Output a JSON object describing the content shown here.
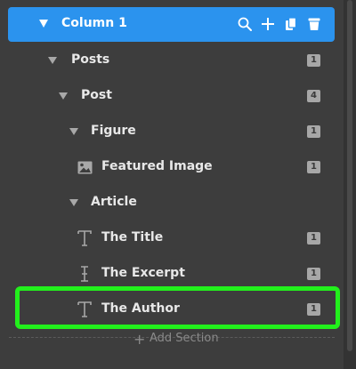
{
  "header": {
    "title": "Column 1",
    "bg_color": "#2b93ee",
    "actions": [
      "search-icon",
      "plus-icon",
      "duplicate-icon",
      "trash-icon"
    ]
  },
  "tree": [
    {
      "label": "Posts",
      "badge": "1",
      "expanded": true,
      "icon": null
    },
    {
      "label": "Post",
      "badge": "4",
      "expanded": true,
      "icon": null
    },
    {
      "label": "Figure",
      "badge": "1",
      "expanded": true,
      "icon": null
    },
    {
      "label": "Featured Image",
      "badge": "1",
      "icon": "image-icon"
    },
    {
      "label": "Article",
      "badge": "",
      "expanded": true,
      "icon": null
    },
    {
      "label": "The Title",
      "badge": "1",
      "icon": "text-icon"
    },
    {
      "label": "The Excerpt",
      "badge": "1",
      "icon": "text-cursor-icon"
    },
    {
      "label": "The Author",
      "badge": "1",
      "icon": "text-icon",
      "highlighted": true
    }
  ],
  "footer": {
    "add_section_label": "Add Section"
  },
  "colors": {
    "highlight": "#22f01c",
    "panel_bg": "#3d3d3d",
    "badge_bg": "#a7a7a7"
  }
}
